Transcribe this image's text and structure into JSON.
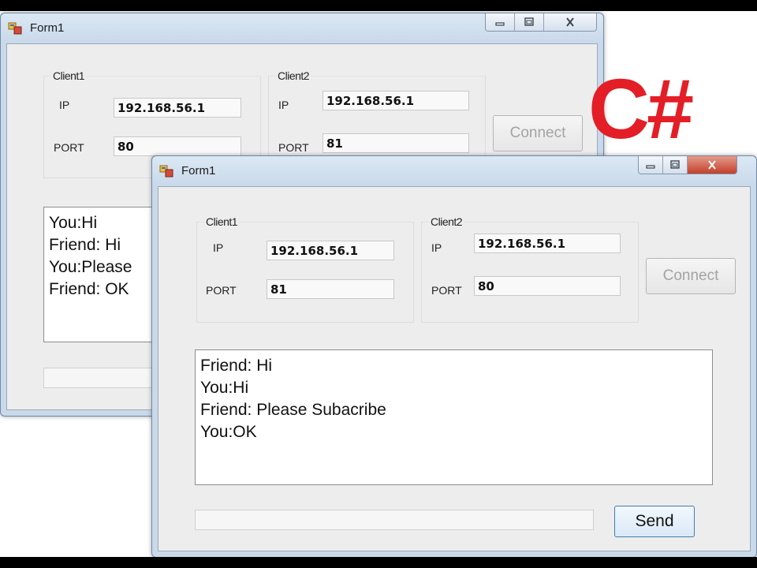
{
  "logo_text": "C#",
  "back_window": {
    "title": "Form1",
    "group1": {
      "label": "Client1",
      "ip_label": "IP",
      "ip_value": "192.168.56.1",
      "port_label": "PORT",
      "port_value": "80"
    },
    "group2": {
      "label": "Client2",
      "ip_label": "IP",
      "ip_value": "192.168.56.1",
      "port_label": "PORT",
      "port_value": "81"
    },
    "connect_label": "Connect",
    "chat_lines": [
      "You:Hi",
      "Friend: Hi",
      "You:Please",
      "Friend: OK"
    ],
    "message_value": ""
  },
  "front_window": {
    "title": "Form1",
    "group1": {
      "label": "Client1",
      "ip_label": "IP",
      "ip_value": "192.168.56.1",
      "port_label": "PORT",
      "port_value": "81"
    },
    "group2": {
      "label": "Client2",
      "ip_label": "IP",
      "ip_value": "192.168.56.1",
      "port_label": "PORT",
      "port_value": "80"
    },
    "connect_label": "Connect",
    "chat_lines": [
      "Friend: Hi",
      "You:Hi",
      "Friend: Please Subacribe",
      "You:OK"
    ],
    "message_value": "",
    "send_label": "Send"
  },
  "window_controls": {
    "minimize": "minimize-icon",
    "maximize": "maximize-icon",
    "close": "close-icon"
  },
  "colors": {
    "logo_red": "#e41e26",
    "send_border": "#3c7fb1",
    "title_bar": "#c8d9ea"
  }
}
